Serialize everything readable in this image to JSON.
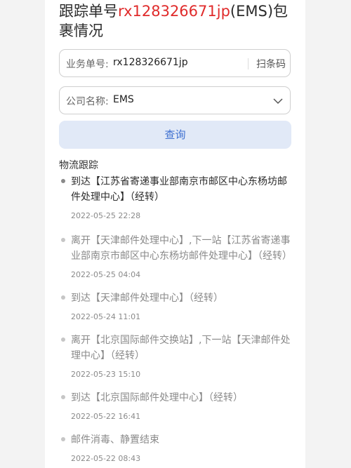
{
  "title": {
    "prefix": "跟踪单号",
    "highlight": "rx128326671jp",
    "suffix": "(EMS)包裹情况"
  },
  "form": {
    "tracking_label": "业务单号:",
    "tracking_value": "rx128326671jp",
    "scan_label": "扫条码",
    "company_label": "公司名称:",
    "company_value": "EMS",
    "query_label": "查询"
  },
  "section_title": "物流跟踪",
  "events": [
    {
      "desc": "到达【江苏省寄递事业部南京市邮区中心东杨坊邮件处理中心】（经转）",
      "time": "2022-05-25 22:28"
    },
    {
      "desc": "离开【天津邮件处理中心】,下一站【江苏省寄递事业部南京市邮区中心东杨坊邮件处理中心】（经转）",
      "time": "2022-05-25 04:04"
    },
    {
      "desc": "到达【天津邮件处理中心】（经转）",
      "time": "2022-05-24 11:01"
    },
    {
      "desc": "离开【北京国际邮件交换站】,下一站【天津邮件处理中心】（经转）",
      "time": "2022-05-23 15:10"
    },
    {
      "desc": "到达【北京国际邮件处理中心】（经转）",
      "time": "2022-05-22 16:41"
    },
    {
      "desc": "邮件消毒、静置结束",
      "time": "2022-05-22 08:43"
    }
  ]
}
